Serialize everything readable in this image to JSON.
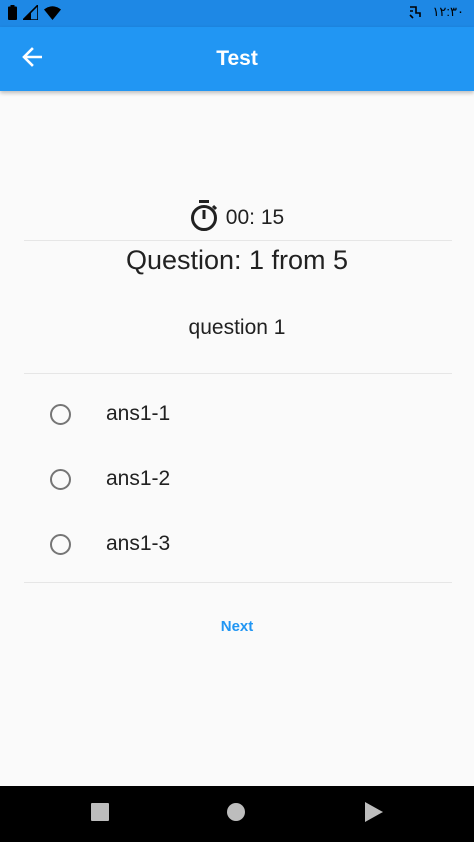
{
  "status_bar": {
    "time": "١٢:٣٠",
    "icons": [
      "battery-icon",
      "signal-icon",
      "wifi-icon",
      "data-saver-icon"
    ]
  },
  "app_bar": {
    "title": "Test",
    "back_icon": "arrow-left-icon",
    "color": "#2196f3"
  },
  "timer": {
    "icon": "stopwatch-icon",
    "value": "00: 15"
  },
  "question": {
    "header": "Question: 1 from 5",
    "text": "question 1"
  },
  "answers": [
    {
      "label": "ans1-1",
      "selected": false
    },
    {
      "label": "ans1-2",
      "selected": false
    },
    {
      "label": "ans1-3",
      "selected": false
    }
  ],
  "actions": {
    "next_label": "Next"
  },
  "nav_bar": {
    "buttons": [
      "recents-icon",
      "home-icon",
      "back-triangle-icon"
    ]
  }
}
